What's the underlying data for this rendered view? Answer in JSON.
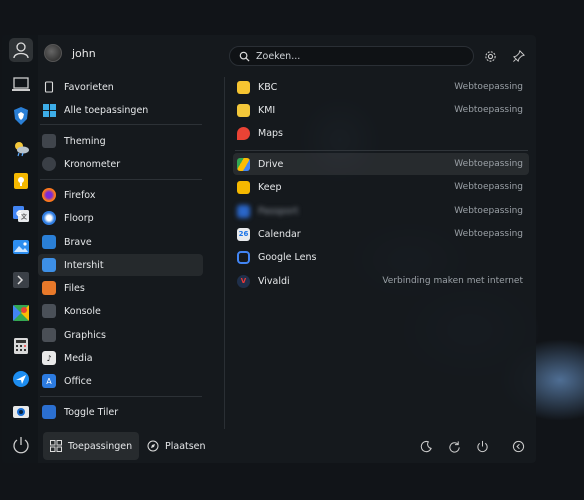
{
  "user": {
    "name": "john"
  },
  "search": {
    "placeholder": "Zoeken..."
  },
  "favorites": [
    {
      "icon": "user-icon"
    },
    {
      "icon": "computer-icon"
    },
    {
      "icon": "brave-icon"
    },
    {
      "icon": "weather-icon"
    },
    {
      "icon": "keep-icon"
    },
    {
      "icon": "translate-icon"
    },
    {
      "icon": "image-viewer-icon"
    },
    {
      "icon": "terminal-icon"
    },
    {
      "icon": "maps-icon"
    },
    {
      "icon": "calculator-icon"
    },
    {
      "icon": "browser-icon"
    },
    {
      "icon": "screenshot-icon"
    },
    {
      "icon": "power-icon"
    }
  ],
  "categories": [
    {
      "label": "Favorieten"
    },
    {
      "label": "Alle toepassingen"
    },
    {
      "label": "Theming"
    },
    {
      "label": "Kronometer"
    },
    {
      "label": "Firefox"
    },
    {
      "label": "Floorp"
    },
    {
      "label": "Brave"
    },
    {
      "label": "Intershit"
    },
    {
      "label": "Files"
    },
    {
      "label": "Konsole"
    },
    {
      "label": "Graphics"
    },
    {
      "label": "Media"
    },
    {
      "label": "Office"
    },
    {
      "label": "Toggle Tiler"
    }
  ],
  "apps": [
    {
      "name": "KBC",
      "desc": "Webtoepassing"
    },
    {
      "name": "KMI",
      "desc": "Webtoepassing"
    },
    {
      "name": "Maps",
      "desc": ""
    },
    {
      "name": "Drive",
      "desc": "Webtoepassing"
    },
    {
      "name": "Keep",
      "desc": "Webtoepassing"
    },
    {
      "name": "Passport",
      "desc": "Webtoepassing"
    },
    {
      "name": "Calendar",
      "desc": "Webtoepassing"
    },
    {
      "name": "Google Lens",
      "desc": ""
    },
    {
      "name": "Vivaldi",
      "desc": "Verbinding maken met internet"
    }
  ],
  "bottom": {
    "applications_label": "Toepassingen",
    "places_label": "Plaatsen"
  },
  "colors": {
    "accent": "#3daee9",
    "panel": "#16191d"
  }
}
